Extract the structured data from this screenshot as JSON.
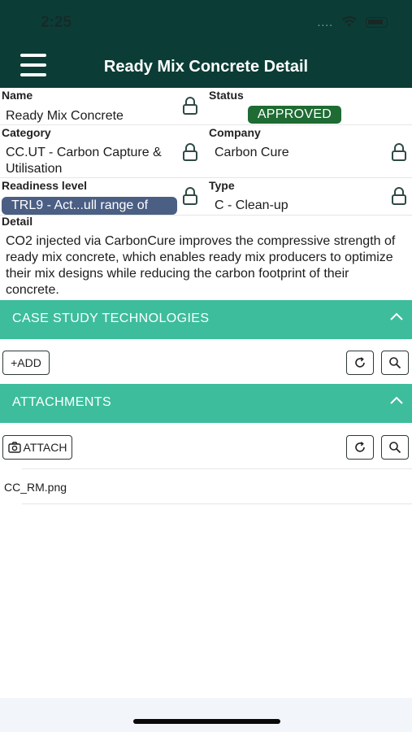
{
  "statusbar": {
    "time": "2:25",
    "signal_dots": "...."
  },
  "header": {
    "title": "Ready Mix Concrete Detail"
  },
  "fields": {
    "name": {
      "label": "Name",
      "value": "Ready Mix Concrete"
    },
    "status": {
      "label": "Status",
      "value": "APPROVED"
    },
    "category": {
      "label": "Category",
      "value": "CC.UT - Carbon Capture & Utilisation"
    },
    "company": {
      "label": "Company",
      "value": "Carbon Cure"
    },
    "readiness": {
      "label": "Readiness level",
      "value": "TRL9 - Act...ull range of"
    },
    "type": {
      "label": "Type",
      "value": "C - Clean-up"
    },
    "detail": {
      "label": "Detail",
      "value": "CO2 injected via CarbonCure  improves the compressive strength of ready mix concrete, which enables ready mix producers to optimize their mix designs while reducing the carbon footprint of their concrete."
    }
  },
  "sections": {
    "case_study": {
      "title": "CASE STUDY TECHNOLOGIES",
      "add_label": "+ADD"
    },
    "attachments": {
      "title": "ATTACHMENTS",
      "attach_label": "ATTACH",
      "files": [
        "CC_RM.png"
      ]
    }
  },
  "colors": {
    "header_bg": "#0b3d36",
    "section_bar": "#3dbd9c",
    "approved_badge": "#1f6b34",
    "readiness_badge": "#4b5f84"
  },
  "icons": {
    "menu": "hamburger-icon",
    "lock": "lock-icon",
    "collapse": "chevron-up-icon",
    "refresh": "refresh-icon",
    "search": "search-icon",
    "camera": "camera-icon",
    "wifi": "wifi-icon",
    "battery": "battery-icon"
  }
}
